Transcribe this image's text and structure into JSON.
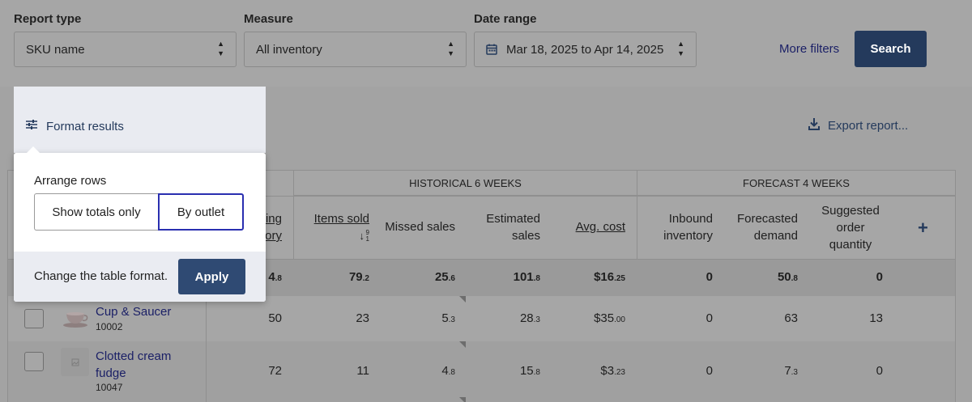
{
  "filters": {
    "report_type": {
      "label": "Report type",
      "value": "SKU name"
    },
    "measure": {
      "label": "Measure",
      "value": "All inventory"
    },
    "date_range": {
      "label": "Date range",
      "value": "Mar 18, 2025 to Apr 14, 2025"
    },
    "more_filters": "More filters",
    "search": "Search"
  },
  "toolbar": {
    "format_results": "Format results",
    "export_report": "Export report..."
  },
  "popover": {
    "title": "Arrange rows",
    "options": [
      "Show totals only",
      "By outlet"
    ],
    "selected": "By outlet",
    "footer_text": "Change the table format.",
    "apply": "Apply"
  },
  "table": {
    "groups": {
      "historical": "HISTORICAL 6 WEEKS",
      "forecast": "FORECAST 4 WEEKS"
    },
    "columns": {
      "closing_inventory": [
        "ing",
        "ory"
      ],
      "items_sold": "Items sold",
      "items_sold_sort": "9 1",
      "missed_sales": "Missed sales",
      "estimated_sales": [
        "Estimated",
        "sales"
      ],
      "avg_cost": "Avg. cost",
      "inbound_inventory": [
        "Inbound",
        "inventory"
      ],
      "forecasted_demand": [
        "Forecasted",
        "demand"
      ],
      "suggested_order": [
        "Suggested",
        "order",
        "quantity"
      ]
    },
    "totals": {
      "closing_inventory": {
        "main": "4",
        "dec": ".8"
      },
      "items_sold": {
        "main": "79",
        "dec": ".2"
      },
      "missed_sales": {
        "main": "25",
        "dec": ".6"
      },
      "estimated_sales": {
        "main": "101",
        "dec": ".8"
      },
      "avg_cost": {
        "main": "$16",
        "dec": ".25"
      },
      "inbound_inventory": "0",
      "forecasted_demand": {
        "main": "50",
        "dec": ".8"
      },
      "suggested_order": "0"
    },
    "rows": [
      {
        "name": "Cup & Saucer",
        "sku": "10002",
        "closing_inventory": "50",
        "items_sold": "23",
        "missed_sales": {
          "main": "5",
          "dec": ".3"
        },
        "estimated_sales": {
          "main": "28",
          "dec": ".3"
        },
        "avg_cost": {
          "main": "$35",
          "dec": ".00"
        },
        "inbound_inventory": "0",
        "forecasted_demand": "63",
        "suggested_order": "13"
      },
      {
        "name_lines": [
          "Clotted cream",
          "fudge"
        ],
        "sku": "10047",
        "closing_inventory": "72",
        "items_sold": "11",
        "missed_sales": {
          "main": "4",
          "dec": ".8"
        },
        "estimated_sales": {
          "main": "15",
          "dec": ".8"
        },
        "avg_cost": {
          "main": "$3",
          "dec": ".23"
        },
        "inbound_inventory": "0",
        "forecasted_demand": {
          "main": "7",
          "dec": ".3"
        },
        "suggested_order": "0"
      }
    ]
  },
  "colors": {
    "primary": "#243a5c",
    "link": "#1a1f66",
    "selected_border": "#2a2fb0",
    "overlay": "#a6a6a6"
  }
}
